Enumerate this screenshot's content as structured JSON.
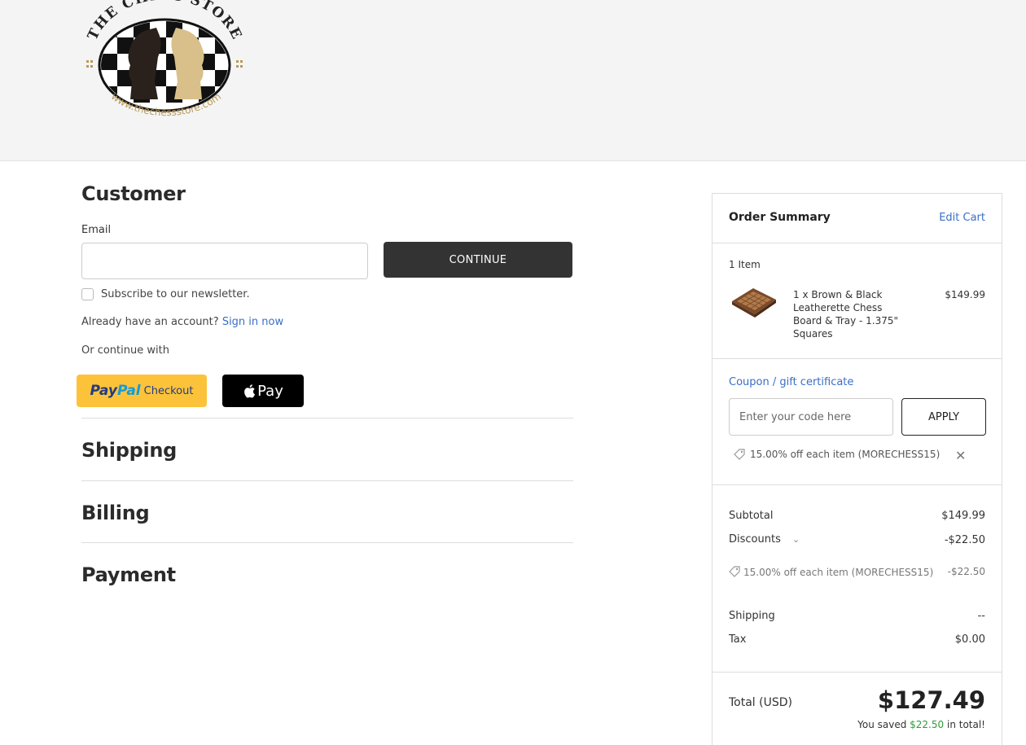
{
  "header": {
    "logo_text": "THE CHESS STORE",
    "logo_url_text": "www.thechessstore.com"
  },
  "customer": {
    "title": "Customer",
    "email_label": "Email",
    "email_value": "",
    "continue_label": "CONTINUE",
    "newsletter_label": "Subscribe to our newsletter.",
    "account_prompt": "Already have an account?",
    "sign_in_label": "Sign in now",
    "or_continue": "Or continue with",
    "paypal_pay": "Pay",
    "paypal_pal": "Pal",
    "paypal_checkout": "Checkout",
    "applepay_label": "Pay"
  },
  "steps": {
    "shipping": "Shipping",
    "billing": "Billing",
    "payment": "Payment"
  },
  "summary": {
    "title": "Order Summary",
    "edit_cart": "Edit Cart",
    "item_count": "1 Item",
    "item": {
      "name": "1 x Brown & Black Leatherette Chess Board & Tray - 1.375\" Squares",
      "price": "$149.99"
    },
    "coupon_link": "Coupon / gift certificate",
    "coupon_placeholder": "Enter your code here",
    "apply_label": "APPLY",
    "applied_coupon": "15.00% off each item (MORECHESS15)",
    "subtotal_label": "Subtotal",
    "subtotal_value": "$149.99",
    "discounts_label": "Discounts",
    "discounts_value": "-$22.50",
    "discount_detail": "15.00% off each item (MORECHESS15)",
    "discount_detail_value": "-$22.50",
    "shipping_label": "Shipping",
    "shipping_value": "--",
    "tax_label": "Tax",
    "tax_value": "$0.00",
    "total_label": "Total (USD)",
    "total_value": "$127.49",
    "saved_prefix": "You saved",
    "saved_amount": "$22.50",
    "saved_suffix": "in total!"
  },
  "colors": {
    "link": "#3a6fc4",
    "button_dark": "#333333",
    "paypal": "#fcc33a",
    "saved_green": "#2f9a3a"
  }
}
